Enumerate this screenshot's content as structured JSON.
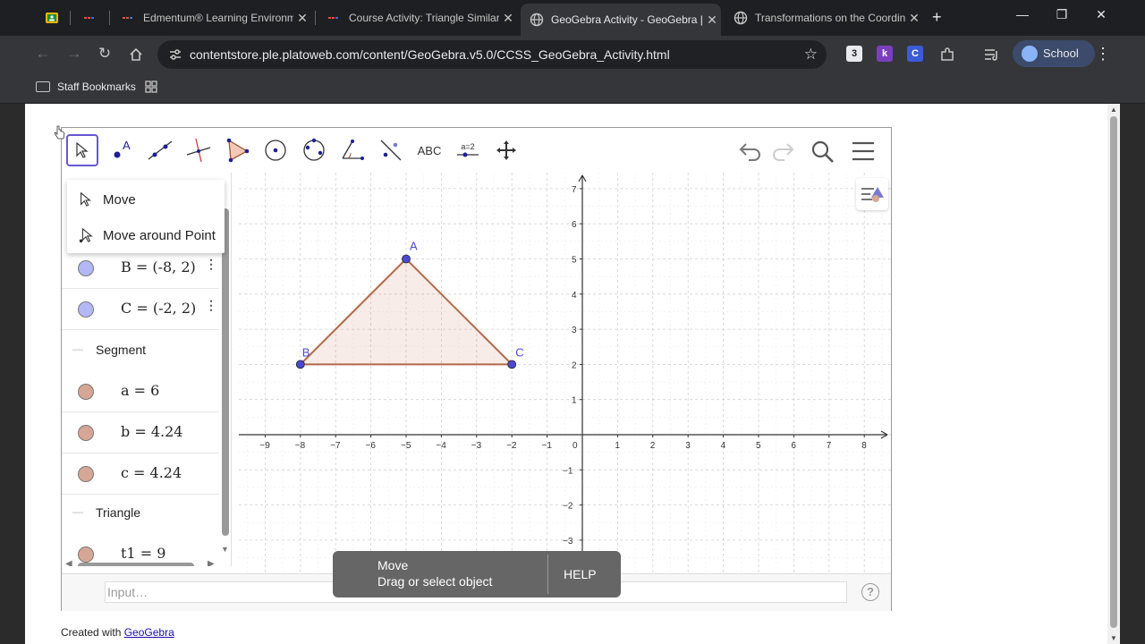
{
  "browser": {
    "tabs": [
      {
        "title": "",
        "favicon": "google-classroom-icon",
        "active": false
      },
      {
        "title": "Edmentum® Learning Environm",
        "favicon": "edmentum-icon",
        "active": false
      },
      {
        "title": "Course Activity: Triangle Similar",
        "favicon": "edmentum-icon",
        "active": false
      },
      {
        "title": "GeoGebra Activity - GeoGebra |",
        "favicon": "globe-icon",
        "active": true
      },
      {
        "title": "Transformations on the Coordin",
        "favicon": "globe-icon",
        "active": false
      }
    ],
    "new_tab": "+",
    "url": "contentstore.ple.platoweb.com/content/GeoGebra.v5.0/CCSS_GeoGebra_Activity.html",
    "profile_label": "School",
    "bookmarks": [
      {
        "label": "Staff Bookmarks"
      }
    ],
    "extensions": [
      {
        "label": "3",
        "color": "#e8eaed"
      },
      {
        "label": "k",
        "color": "#7b3fbe"
      },
      {
        "label": "C",
        "color": "#3b5bd9"
      }
    ]
  },
  "geogebra": {
    "tools": [
      {
        "name": "move-tool",
        "icon": "arrow-cursor-icon",
        "label": "",
        "selected": true
      },
      {
        "name": "point-tool",
        "icon": "point-icon",
        "label": "A",
        "selected": false
      },
      {
        "name": "line-tool",
        "icon": "line-icon",
        "label": "",
        "selected": false
      },
      {
        "name": "perpendicular-tool",
        "icon": "perpendicular-icon",
        "label": "",
        "selected": false
      },
      {
        "name": "polygon-tool",
        "icon": "polygon-icon",
        "label": "",
        "selected": false
      },
      {
        "name": "circle-tool",
        "icon": "circle-icon",
        "label": "",
        "selected": false
      },
      {
        "name": "ellipse-tool",
        "icon": "ellipse-icon",
        "label": "",
        "selected": false
      },
      {
        "name": "angle-tool",
        "icon": "angle-icon",
        "label": "",
        "selected": false
      },
      {
        "name": "reflect-tool",
        "icon": "reflect-icon",
        "label": "",
        "selected": false
      },
      {
        "name": "text-tool",
        "icon": "text-icon",
        "label": "ABC",
        "selected": false
      },
      {
        "name": "slider-tool",
        "icon": "slider-icon",
        "label": "a=2",
        "selected": false
      },
      {
        "name": "move-graphics-tool",
        "icon": "move-view-icon",
        "label": "",
        "selected": false
      }
    ],
    "dropdown": [
      {
        "label": "Move",
        "icon": "arrow-cursor-icon"
      },
      {
        "label": "Move around Point",
        "icon": "rotate-cursor-icon"
      }
    ],
    "algebra": {
      "points": [
        {
          "text": "B = (-8, 2)",
          "color": "#b3b8f5"
        },
        {
          "text": "C = (-2, 2)",
          "color": "#b3b8f5"
        }
      ],
      "segment_header": "Segment",
      "segments": [
        {
          "text": "a = 6",
          "color": "#d6a796"
        },
        {
          "text": "b = 4.24",
          "color": "#d6a796"
        },
        {
          "text": "c = 4.24",
          "color": "#d6a796"
        }
      ],
      "triangle_header": "Triangle",
      "triangles": [
        {
          "text": "t1 = 9",
          "color": "#d6a796"
        }
      ]
    },
    "graph": {
      "x_ticks": [
        "−9",
        "−8",
        "−7",
        "−6",
        "−5",
        "−4",
        "−3",
        "−2",
        "−1",
        "0",
        "1",
        "2",
        "3",
        "4",
        "5",
        "6",
        "7",
        "8"
      ],
      "y_ticks": [
        "7",
        "6",
        "5",
        "4",
        "3",
        "2",
        "1",
        "−1",
        "−2",
        "−3"
      ],
      "points": [
        {
          "label": "A",
          "x": -5,
          "y": 5
        },
        {
          "label": "B",
          "x": -8,
          "y": 2
        },
        {
          "label": "C",
          "x": -2,
          "y": 2
        }
      ],
      "point_color": "#4a4ad0",
      "triangle_color": "#b06a4a"
    },
    "input_placeholder": "Input…",
    "help_icon": "?",
    "toast": {
      "title": "Move",
      "subtitle": "Drag or select object",
      "help": "HELP"
    }
  },
  "footer": {
    "created_prefix": "Created with ",
    "created_link": "GeoGebra"
  }
}
